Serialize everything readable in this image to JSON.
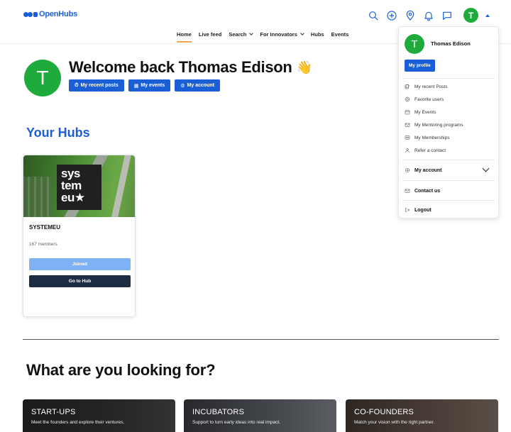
{
  "brand": {
    "name": "OpenHubs",
    "color": "#1b5fd6"
  },
  "header": {
    "icons": [
      "search-icon",
      "plus-circle-icon",
      "location-pin-icon",
      "bell-icon",
      "chat-icon"
    ],
    "avatar_initial": "T"
  },
  "nav": {
    "items": [
      {
        "label": "Home",
        "active": true,
        "has_dropdown": false
      },
      {
        "label": "Live feed",
        "active": false,
        "has_dropdown": false
      },
      {
        "label": "Search",
        "active": false,
        "has_dropdown": true
      },
      {
        "label": "For Innovators",
        "active": false,
        "has_dropdown": true
      },
      {
        "label": "Hubs",
        "active": false,
        "has_dropdown": false
      },
      {
        "label": "Events",
        "active": false,
        "has_dropdown": false
      }
    ]
  },
  "welcome": {
    "avatar_initial": "T",
    "title": "Welcome back Thomas Edison",
    "wave": "👋",
    "buttons": {
      "recent_posts": "My recent posts",
      "events": "My events",
      "account": "My account"
    }
  },
  "hubs": {
    "title": "Your Hubs",
    "card": {
      "logo_lines": [
        "sys",
        "tem",
        "eu★"
      ],
      "name": "SYSTEMEU",
      "members": "167 members",
      "joined_label": "Joined",
      "go_label": "Go to Hub"
    }
  },
  "looking": {
    "title": "What are you looking for?",
    "categories": [
      {
        "title": "START-UPS",
        "desc": "Meet the founders and explore their ventures."
      },
      {
        "title": "INCUBATORS",
        "desc": "Support to turn early ideas into real impact."
      },
      {
        "title": "CO-FOUNDERS",
        "desc": "Match your vision with the right partner."
      }
    ]
  },
  "dropdown": {
    "avatar_initial": "T",
    "name": "Thomas Edison",
    "profile_button": "My profile",
    "items": {
      "recent_posts": "My recent Posts",
      "favorite_users": "Favorite users",
      "events": "My Events",
      "mentoring": "My Mentoring programs",
      "memberships": "My Memberships",
      "refer": "Refer a contact"
    },
    "account": "My account",
    "contact": "Contact us",
    "logout": "Logout"
  },
  "colors": {
    "primary": "#1b5fd6",
    "avatar_green": "#1fab3b",
    "nav_active_underline": "#f2a541",
    "joined_button": "#7fb1f5",
    "go_button": "#1f2d44"
  }
}
